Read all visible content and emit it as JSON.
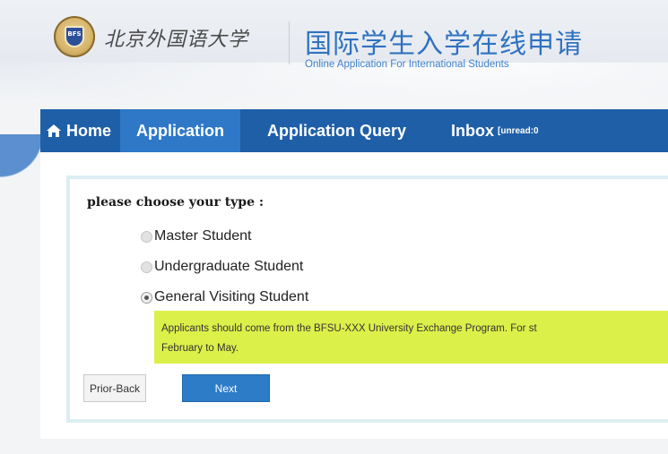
{
  "header": {
    "university_logo_text": "北京外国语大学",
    "title_cn": "国际学生入学在线申请",
    "title_en": "Online Application For International Students",
    "seal_text": "BFS"
  },
  "nav": {
    "home": "Home",
    "application": "Application",
    "application_query": "Application Query",
    "inbox": "Inbox",
    "inbox_unread": "[unread:0"
  },
  "form": {
    "prompt": "please choose your type :",
    "options": [
      {
        "label": "Master Student",
        "checked": false
      },
      {
        "label": "Undergraduate Student",
        "checked": false
      },
      {
        "label": "General Visiting Student",
        "checked": true
      }
    ],
    "notice_line1": "Applicants should come from the BFSU-XXX University Exchange Program. For st",
    "notice_line2": "February to May.",
    "prior_button": "Prior-Back",
    "next_button": "Next"
  },
  "colors": {
    "nav_bg": "#1f5fa8",
    "nav_active": "#2e78c7",
    "title_blue": "#2f72c0",
    "notice_bg": "#dcf04a",
    "next_btn": "#2c7cc8"
  }
}
